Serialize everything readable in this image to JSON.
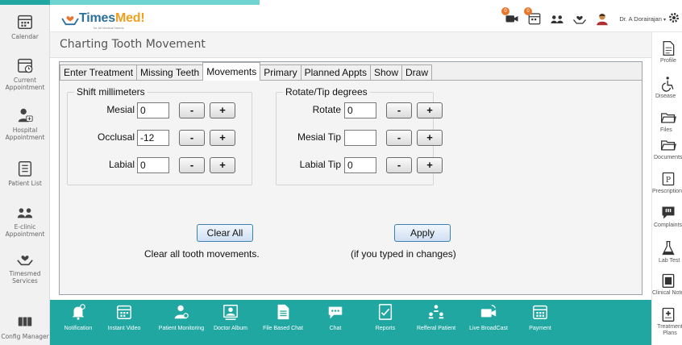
{
  "header": {
    "logo_main": "Times",
    "logo_accent": "Med",
    "logo_suffix": "!",
    "logo_tagline": "for All Medical Needs",
    "notification_counts": [
      "0",
      "0"
    ],
    "user_name": "Dr. A Dorairajan",
    "user_menu_arrow": "▾"
  },
  "page": {
    "title": "Charting Tooth Movement"
  },
  "left_sidebar": {
    "items": [
      {
        "label": "Calendar",
        "icon": "calendar-icon"
      },
      {
        "label": "Current Appointment",
        "icon": "calendar-clock-icon"
      },
      {
        "label": "Hospital Appointment",
        "icon": "doctor-icon"
      },
      {
        "label": "Patient List",
        "icon": "list-icon"
      },
      {
        "label": "E-clinic Appointment",
        "icon": "users-icon"
      },
      {
        "label": "Timesmed Services",
        "icon": "hands-heart-icon"
      },
      {
        "label": "Config Manager",
        "icon": "config-icon"
      }
    ]
  },
  "right_sidebar": {
    "items": [
      {
        "label": "Profile",
        "icon": "document-icon"
      },
      {
        "label": "Disease",
        "icon": "wheelchair-icon"
      },
      {
        "label": "Files",
        "icon": "folder-icon"
      },
      {
        "label": "Documents",
        "icon": "folder-icon"
      },
      {
        "label": "Prescription",
        "icon": "prescription-icon"
      },
      {
        "label": "Complaints",
        "icon": "speech-alert-icon"
      },
      {
        "label": "Lab Test",
        "icon": "flask-icon"
      },
      {
        "label": "Clinical Notes",
        "icon": "clipboard-icon"
      },
      {
        "label": "Treatment Plans",
        "icon": "plus-box-icon"
      }
    ]
  },
  "form": {
    "tabs": [
      "Enter Treatment",
      "Missing Teeth",
      "Movements",
      "Primary",
      "Planned Appts",
      "Show",
      "Draw"
    ],
    "active_tab": "Movements",
    "shift_group": {
      "title": "Shift millimeters",
      "rows": [
        {
          "label": "Mesial",
          "value": "0"
        },
        {
          "label": "Occlusal",
          "value": "-12"
        },
        {
          "label": "Labial",
          "value": "0"
        }
      ]
    },
    "rotate_group": {
      "title": "Rotate/Tip degrees",
      "rows": [
        {
          "label": "Rotate",
          "value": "0"
        },
        {
          "label": "Mesial Tip",
          "value": ""
        },
        {
          "label": "Labial Tip",
          "value": "0"
        }
      ]
    },
    "minus_label": "-",
    "plus_label": "+",
    "clear_all_label": "Clear All",
    "clear_all_caption": "Clear all tooth movements.",
    "apply_label": "Apply",
    "apply_caption": "(if you typed in changes)"
  },
  "bottom_bar": {
    "items": [
      {
        "label": "Notification",
        "icon": "bell-icon"
      },
      {
        "label": "Instant Video",
        "icon": "calendar-video-icon"
      },
      {
        "label": "Patient Monitoring",
        "icon": "patient-monitor-icon"
      },
      {
        "label": "Doctor Album",
        "icon": "album-icon"
      },
      {
        "label": "File Based Chat",
        "icon": "file-chat-icon"
      },
      {
        "label": "Chat",
        "icon": "chat-icon"
      },
      {
        "label": "Reports",
        "icon": "report-icon"
      },
      {
        "label": "Refferal Patient",
        "icon": "referral-icon"
      },
      {
        "label": "Live BroadCast",
        "icon": "broadcast-icon"
      },
      {
        "label": "Payment",
        "icon": "payment-icon"
      }
    ]
  },
  "colors": {
    "teal": "#21a7a2",
    "brand_blue": "#2b6f9a",
    "brand_orange": "#f0a020",
    "badge": "#e8772e"
  }
}
